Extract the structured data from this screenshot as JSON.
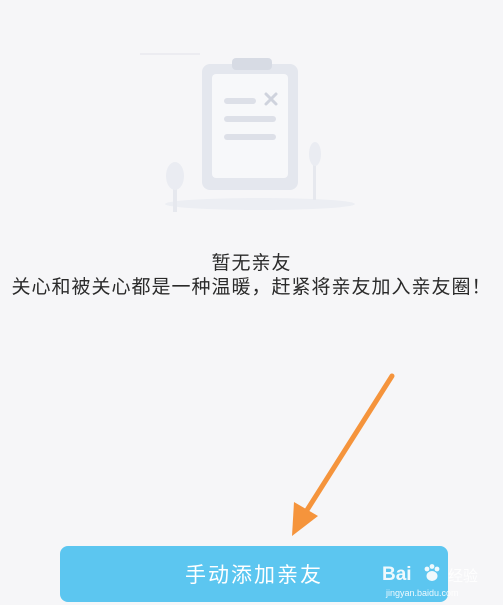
{
  "empty_state": {
    "title": "暂无亲友",
    "description": "关心和被关心都是一种温暖，赶紧将亲友加入亲友圈！",
    "illustration_icon": "clipboard-icon"
  },
  "actions": {
    "add_button_label": "手动添加亲友"
  },
  "annotation": {
    "arrow_color": "#f5943c"
  },
  "watermark": {
    "logo": "Bai",
    "logo_suffix": "经验",
    "subtext": "jingyan.baidu.com"
  },
  "colors": {
    "background": "#f6f6f8",
    "button": "#5cc6f0",
    "text": "#2a2a2a",
    "illustration": "#e4e7ee"
  }
}
